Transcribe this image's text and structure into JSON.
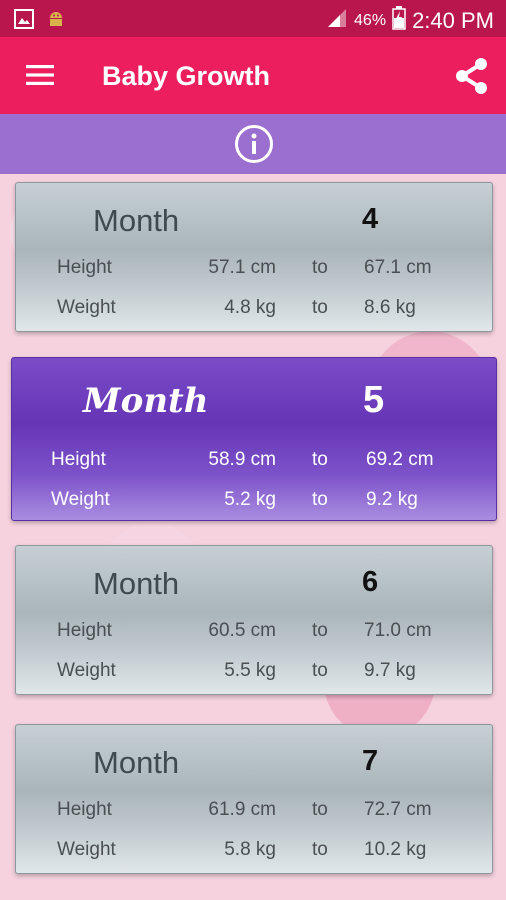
{
  "status_bar": {
    "battery": "46%",
    "time": "2:40 PM",
    "icons": [
      "image-icon",
      "android-icon",
      "signal-icon",
      "battery-charging-icon"
    ]
  },
  "app": {
    "title": "Baby Growth",
    "menu_icon": "menu-icon",
    "share_icon": "share-icon",
    "info_icon": "info-icon",
    "colors": {
      "toolbar": "#ec1e5e",
      "status_bar": "#b8164c",
      "info_bar": "#9b6fd0",
      "active_card": "#6535b6"
    }
  },
  "cards": [
    {
      "month_label": "Month",
      "month": "4",
      "height_label": "Height",
      "height_from": "57.1 cm",
      "height_to": "67.1 cm",
      "weight_label": "Weight",
      "weight_from": "4.8 kg",
      "weight_to": "8.6 kg",
      "to_label": "to"
    },
    {
      "month_label": "Month",
      "month": "5",
      "height_label": "Height",
      "height_from": "58.9 cm",
      "height_to": "69.2 cm",
      "weight_label": "Weight",
      "weight_from": "5.2 kg",
      "weight_to": "9.2 kg",
      "to_label": "to",
      "selected": true
    },
    {
      "month_label": "Month",
      "month": "6",
      "height_label": "Height",
      "height_from": "60.5 cm",
      "height_to": "71.0 cm",
      "weight_label": "Weight",
      "weight_from": "5.5 kg",
      "weight_to": "9.7 kg",
      "to_label": "to"
    },
    {
      "month_label": "Month",
      "month": "7",
      "height_label": "Height",
      "height_from": "61.9 cm",
      "height_to": "72.7 cm",
      "weight_label": "Weight",
      "weight_from": "5.8 kg",
      "weight_to": "10.2 kg",
      "to_label": "to"
    }
  ]
}
